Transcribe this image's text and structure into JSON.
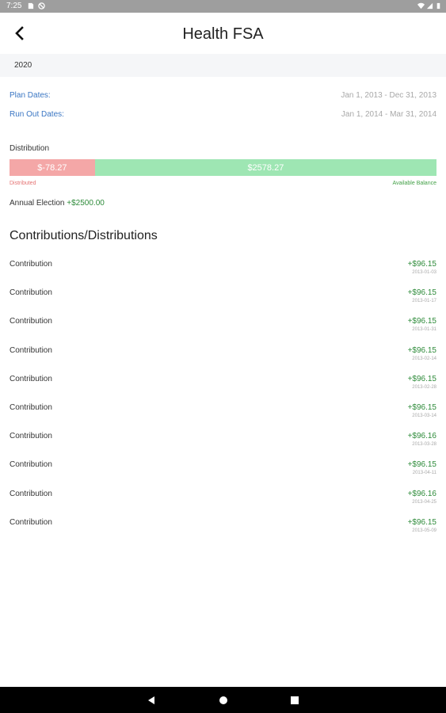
{
  "status_bar": {
    "time": "7:25"
  },
  "header": {
    "title": "Health FSA"
  },
  "year": "2020",
  "plan": {
    "plan_dates_label": "Plan Dates:",
    "plan_dates_value": "Jan 1, 2013 - Dec 31, 2013",
    "run_out_label": "Run Out Dates:",
    "run_out_value": "Jan 1, 2014 - Mar 31, 2014"
  },
  "distribution": {
    "label": "Distribution",
    "distributed_amount": "$-78.27",
    "available_amount": "$2578.27",
    "distributed_label": "Distributed",
    "available_label": "Available Balance",
    "distributed_fraction": 0.2
  },
  "election": {
    "label": "Annual Election",
    "amount": "+$2500.00"
  },
  "section_title": "Contributions/Distributions",
  "transactions": [
    {
      "label": "Contribution",
      "amount": "+$96.15",
      "date": "2013-01-03"
    },
    {
      "label": "Contribution",
      "amount": "+$96.15",
      "date": "2013-01-17"
    },
    {
      "label": "Contribution",
      "amount": "+$96.15",
      "date": "2013-01-31"
    },
    {
      "label": "Contribution",
      "amount": "+$96.15",
      "date": "2013-02-14"
    },
    {
      "label": "Contribution",
      "amount": "+$96.15",
      "date": "2013-02-28"
    },
    {
      "label": "Contribution",
      "amount": "+$96.15",
      "date": "2013-03-14"
    },
    {
      "label": "Contribution",
      "amount": "+$96.16",
      "date": "2013-03-28"
    },
    {
      "label": "Contribution",
      "amount": "+$96.15",
      "date": "2013-04-11"
    },
    {
      "label": "Contribution",
      "amount": "+$96.16",
      "date": "2013-04-25"
    },
    {
      "label": "Contribution",
      "amount": "+$96.15",
      "date": "2013-05-09"
    }
  ],
  "icons": {
    "back": "back-arrow-icon",
    "nav_back": "triangle-back-icon",
    "nav_home": "circle-home-icon",
    "nav_recents": "square-recents-icon"
  }
}
